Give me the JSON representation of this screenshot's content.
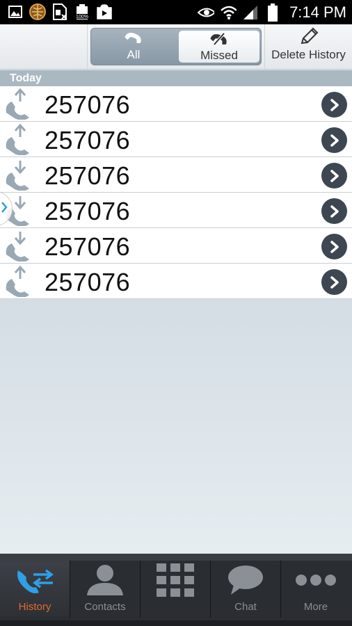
{
  "status_bar": {
    "time": "7:14 PM",
    "left_icons": [
      "gallery-icon",
      "app-globe-icon",
      "sim-card-icon",
      "battery-full-icon",
      "play-store-icon"
    ],
    "right_icons": [
      "eye-icon",
      "wifi-icon",
      "signal-icon",
      "battery-icon"
    ]
  },
  "toolbar": {
    "segment": {
      "all_label": "All",
      "missed_label": "Missed",
      "selected": "all"
    },
    "delete_label": "Delete History"
  },
  "section": {
    "title": "Today"
  },
  "calls": [
    {
      "number": "257076",
      "direction": "outgoing"
    },
    {
      "number": "257076",
      "direction": "outgoing"
    },
    {
      "number": "257076",
      "direction": "incoming"
    },
    {
      "number": "257076",
      "direction": "incoming"
    },
    {
      "number": "257076",
      "direction": "incoming"
    },
    {
      "number": "257076",
      "direction": "outgoing"
    }
  ],
  "tabs": [
    {
      "label": "History",
      "icon": "history-icon",
      "active": true
    },
    {
      "label": "Contacts",
      "icon": "contacts-icon",
      "active": false
    },
    {
      "label": "",
      "icon": "dialpad-icon",
      "active": false
    },
    {
      "label": "Chat",
      "icon": "chat-icon",
      "active": false
    },
    {
      "label": "More",
      "icon": "more-icon",
      "active": false
    }
  ],
  "colors": {
    "accent_orange": "#e26a2c",
    "history_blue": "#2ea0e6",
    "go_button": "#3e4751"
  }
}
